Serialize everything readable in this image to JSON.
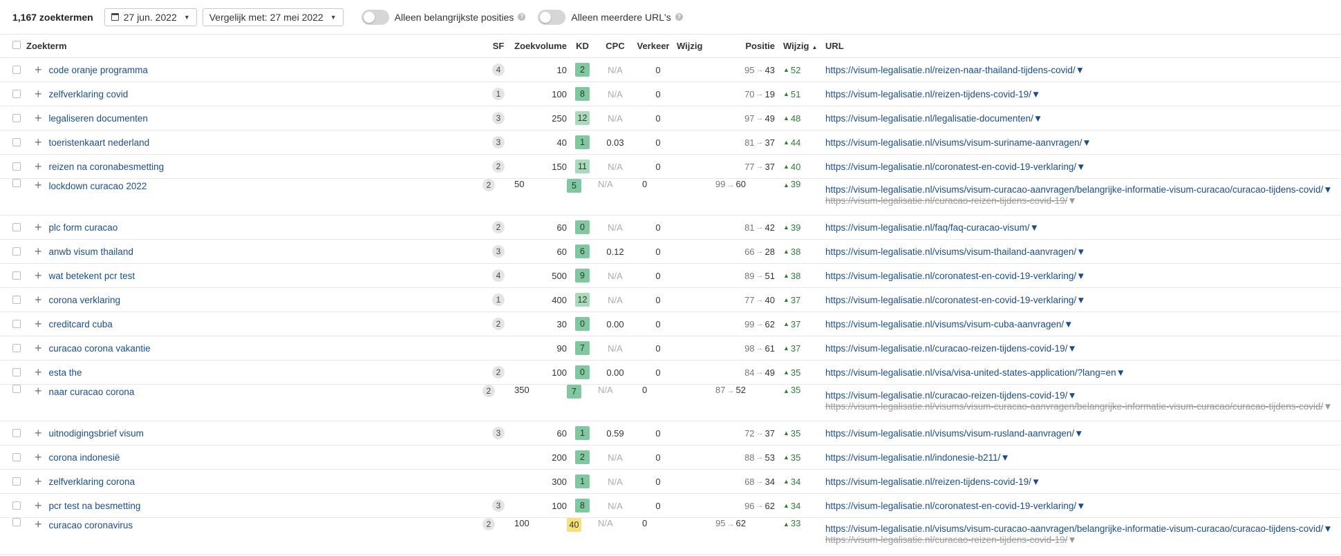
{
  "toolbar": {
    "count_label": "1,167 zoektermen",
    "date": "27 jun. 2022",
    "compare": "Vergelijk met: 27 mei 2022",
    "toggle1_label": "Alleen belangrijkste posities",
    "toggle2_label": "Alleen meerdere URL's",
    "help_glyph": "?"
  },
  "headers": {
    "keyword": "Zoekterm",
    "sf": "SF",
    "volume": "Zoekvolume",
    "kd": "KD",
    "cpc": "CPC",
    "traffic": "Verkeer",
    "change1": "Wijzig",
    "position": "Positie",
    "change2": "Wijzig",
    "url": "URL"
  },
  "kd_colors": {
    "low": "#7fc8a0",
    "low_light": "#a8dbb9",
    "mid": "#f5e07a"
  },
  "rows": [
    {
      "keyword": "code oranje programma",
      "sf": "4",
      "volume": "10",
      "kd": "2",
      "kd_class": "low",
      "cpc": "N/A",
      "traffic": "0",
      "pos_old": "95",
      "pos_new": "43",
      "change": "52",
      "url": "https://visum-legalisatie.nl/reizen-naar-thailand-tijdens-covid/",
      "url2": ""
    },
    {
      "keyword": "zelfverklaring covid",
      "sf": "1",
      "volume": "100",
      "kd": "8",
      "kd_class": "low",
      "cpc": "N/A",
      "traffic": "0",
      "pos_old": "70",
      "pos_new": "19",
      "change": "51",
      "url": "https://visum-legalisatie.nl/reizen-tijdens-covid-19/",
      "url2": ""
    },
    {
      "keyword": "legaliseren documenten",
      "sf": "3",
      "volume": "250",
      "kd": "12",
      "kd_class": "low_light",
      "cpc": "N/A",
      "traffic": "0",
      "pos_old": "97",
      "pos_new": "49",
      "change": "48",
      "url": "https://visum-legalisatie.nl/legalisatie-documenten/",
      "url2": ""
    },
    {
      "keyword": "toeristenkaart nederland",
      "sf": "3",
      "volume": "40",
      "kd": "1",
      "kd_class": "low",
      "cpc": "0.03",
      "traffic": "0",
      "pos_old": "81",
      "pos_new": "37",
      "change": "44",
      "url": "https://visum-legalisatie.nl/visums/visum-suriname-aanvragen/",
      "url2": ""
    },
    {
      "keyword": "reizen na coronabesmetting",
      "sf": "2",
      "volume": "150",
      "kd": "11",
      "kd_class": "low_light",
      "cpc": "N/A",
      "traffic": "0",
      "pos_old": "77",
      "pos_new": "37",
      "change": "40",
      "url": "https://visum-legalisatie.nl/coronatest-en-covid-19-verklaring/",
      "url2": ""
    },
    {
      "keyword": "lockdown curacao 2022",
      "sf": "2",
      "volume": "50",
      "kd": "5",
      "kd_class": "low",
      "cpc": "N/A",
      "traffic": "0",
      "pos_old": "99",
      "pos_new": "60",
      "change": "39",
      "url": "https://visum-legalisatie.nl/visums/visum-curacao-aanvragen/belangrijke-informatie-visum-curacao/curacao-tijdens-covid/",
      "url2": "https://visum-legalisatie.nl/curacao-reizen-tijdens-covid-19/"
    },
    {
      "keyword": "plc form curacao",
      "sf": "2",
      "volume": "60",
      "kd": "0",
      "kd_class": "low",
      "cpc": "N/A",
      "traffic": "0",
      "pos_old": "81",
      "pos_new": "42",
      "change": "39",
      "url": "https://visum-legalisatie.nl/faq/faq-curacao-visum/",
      "url2": ""
    },
    {
      "keyword": "anwb visum thailand",
      "sf": "3",
      "volume": "60",
      "kd": "6",
      "kd_class": "low",
      "cpc": "0.12",
      "traffic": "0",
      "pos_old": "66",
      "pos_new": "28",
      "change": "38",
      "url": "https://visum-legalisatie.nl/visums/visum-thailand-aanvragen/",
      "url2": ""
    },
    {
      "keyword": "wat betekent pcr test",
      "sf": "4",
      "volume": "500",
      "kd": "9",
      "kd_class": "low",
      "cpc": "N/A",
      "traffic": "0",
      "pos_old": "89",
      "pos_new": "51",
      "change": "38",
      "url": "https://visum-legalisatie.nl/coronatest-en-covid-19-verklaring/",
      "url2": ""
    },
    {
      "keyword": "corona verklaring",
      "sf": "1",
      "volume": "400",
      "kd": "12",
      "kd_class": "low_light",
      "cpc": "N/A",
      "traffic": "0",
      "pos_old": "77",
      "pos_new": "40",
      "change": "37",
      "url": "https://visum-legalisatie.nl/coronatest-en-covid-19-verklaring/",
      "url2": ""
    },
    {
      "keyword": "creditcard cuba",
      "sf": "2",
      "volume": "30",
      "kd": "0",
      "kd_class": "low",
      "cpc": "0.00",
      "traffic": "0",
      "pos_old": "99",
      "pos_new": "62",
      "change": "37",
      "url": "https://visum-legalisatie.nl/visums/visum-cuba-aanvragen/",
      "url2": ""
    },
    {
      "keyword": "curacao corona vakantie",
      "sf": "",
      "volume": "90",
      "kd": "7",
      "kd_class": "low",
      "cpc": "N/A",
      "traffic": "0",
      "pos_old": "98",
      "pos_new": "61",
      "change": "37",
      "url": "https://visum-legalisatie.nl/curacao-reizen-tijdens-covid-19/",
      "url2": ""
    },
    {
      "keyword": "esta the",
      "sf": "2",
      "volume": "100",
      "kd": "0",
      "kd_class": "low",
      "cpc": "0.00",
      "traffic": "0",
      "pos_old": "84",
      "pos_new": "49",
      "change": "35",
      "url": "https://visum-legalisatie.nl/visa/visa-united-states-application/?lang=en",
      "url2": ""
    },
    {
      "keyword": "naar curacao corona",
      "sf": "2",
      "volume": "350",
      "kd": "7",
      "kd_class": "low",
      "cpc": "N/A",
      "traffic": "0",
      "pos_old": "87",
      "pos_new": "52",
      "change": "35",
      "url": "https://visum-legalisatie.nl/curacao-reizen-tijdens-covid-19/",
      "url2": "https://visum-legalisatie.nl/visums/visum-curacao-aanvragen/belangrijke-informatie-visum-curacao/curacao-tijdens-covid/"
    },
    {
      "keyword": "uitnodigingsbrief visum",
      "sf": "3",
      "volume": "60",
      "kd": "1",
      "kd_class": "low",
      "cpc": "0.59",
      "traffic": "0",
      "pos_old": "72",
      "pos_new": "37",
      "change": "35",
      "url": "https://visum-legalisatie.nl/visums/visum-rusland-aanvragen/",
      "url2": ""
    },
    {
      "keyword": "corona indonesië",
      "sf": "",
      "volume": "200",
      "kd": "2",
      "kd_class": "low",
      "cpc": "N/A",
      "traffic": "0",
      "pos_old": "88",
      "pos_new": "53",
      "change": "35",
      "url": "https://visum-legalisatie.nl/indonesie-b211/",
      "url2": ""
    },
    {
      "keyword": "zelfverklaring corona",
      "sf": "",
      "volume": "300",
      "kd": "1",
      "kd_class": "low",
      "cpc": "N/A",
      "traffic": "0",
      "pos_old": "68",
      "pos_new": "34",
      "change": "34",
      "url": "https://visum-legalisatie.nl/reizen-tijdens-covid-19/",
      "url2": ""
    },
    {
      "keyword": "pcr test na besmetting",
      "sf": "3",
      "volume": "100",
      "kd": "8",
      "kd_class": "low",
      "cpc": "N/A",
      "traffic": "0",
      "pos_old": "96",
      "pos_new": "62",
      "change": "34",
      "url": "https://visum-legalisatie.nl/coronatest-en-covid-19-verklaring/",
      "url2": ""
    },
    {
      "keyword": "curacao coronavirus",
      "sf": "2",
      "volume": "100",
      "kd": "40",
      "kd_class": "mid",
      "cpc": "N/A",
      "traffic": "0",
      "pos_old": "95",
      "pos_new": "62",
      "change": "33",
      "url": "https://visum-legalisatie.nl/visums/visum-curacao-aanvragen/belangrijke-informatie-visum-curacao/curacao-tijdens-covid/",
      "url2": "https://visum-legalisatie.nl/curacao-reizen-tijdens-covid-19/"
    }
  ]
}
